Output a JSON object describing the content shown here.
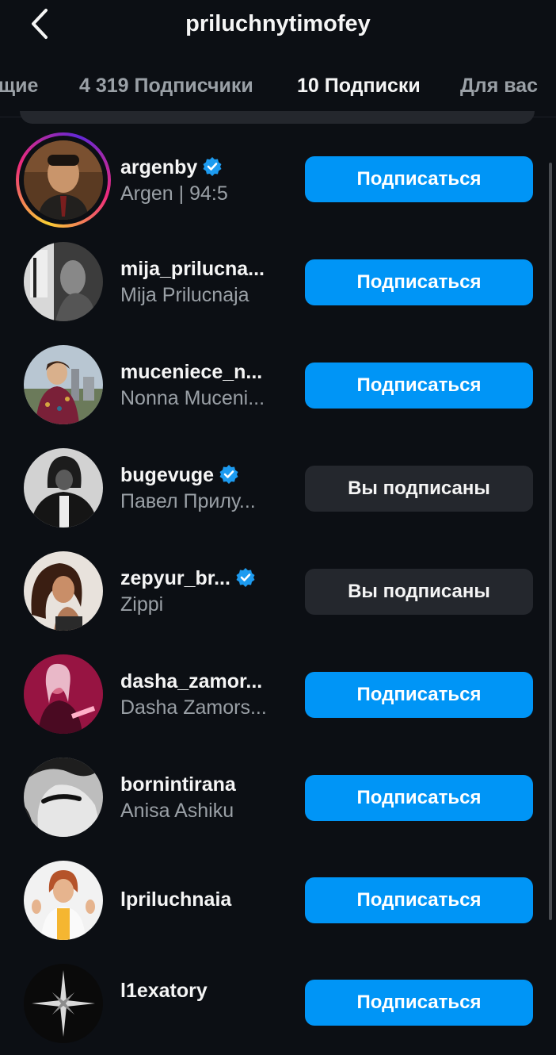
{
  "header": {
    "title": "priluchnytimofey",
    "back_icon": "chevron-left-icon"
  },
  "tabs": [
    {
      "label": "щие"
    },
    {
      "label": "4 319 Подписчики"
    },
    {
      "label": "10 Подписки",
      "active": true
    },
    {
      "label": "Для вас"
    }
  ],
  "colors": {
    "accent": "#0095f6",
    "background": "#0c0f14",
    "secondary_button": "#24272d",
    "verified": "#1d9bf0"
  },
  "accounts": [
    {
      "username": "argenby",
      "verified": true,
      "fullname": "Argen | 94:5",
      "button": "Подписаться",
      "story_ring": true
    },
    {
      "username": "mija_prilucna...",
      "verified": false,
      "fullname": "Mija Prilucnaja",
      "button": "Подписаться"
    },
    {
      "username": "muceniece_n...",
      "verified": false,
      "fullname": "Nonna Muceni...",
      "button": "Подписаться"
    },
    {
      "username": "bugevuge",
      "verified": true,
      "fullname": "Павел Прилу...",
      "button": "Вы подписаны"
    },
    {
      "username": "zepyur_br...",
      "verified": true,
      "fullname": "Zippi",
      "button": "Вы подписаны"
    },
    {
      "username": "dasha_zamor...",
      "verified": false,
      "fullname": "Dasha Zamors...",
      "button": "Подписаться"
    },
    {
      "username": "bornintirana",
      "verified": false,
      "fullname": "Anisa Ashiku",
      "button": "Подписаться"
    },
    {
      "username": "lpriluchnaia",
      "verified": false,
      "fullname": "",
      "button": "Подписаться"
    },
    {
      "username": "l1exatory",
      "verified": false,
      "fullname": "",
      "button": "Подписаться"
    }
  ]
}
